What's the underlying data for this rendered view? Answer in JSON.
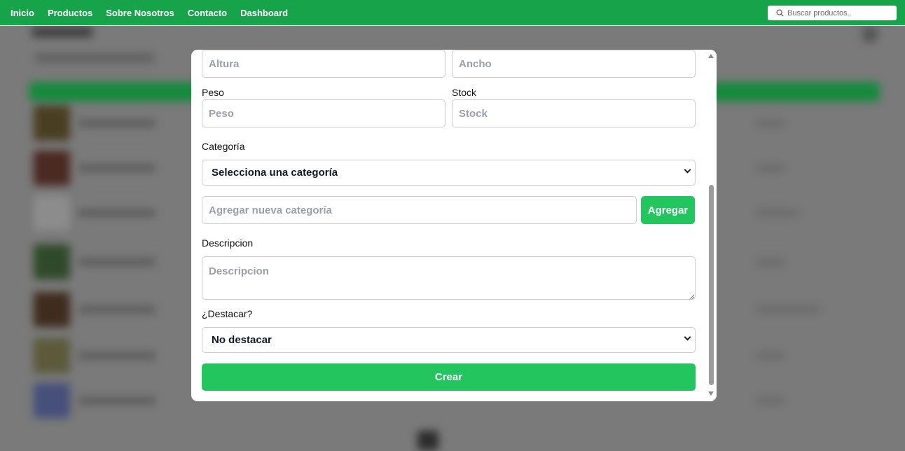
{
  "navbar": {
    "links": [
      "Inicio",
      "Productos",
      "Sobre Nosotros",
      "Contacto",
      "Dashboard"
    ],
    "search_placeholder": "Buscar productos.."
  },
  "colors": {
    "navbar_bg": "#17a34a",
    "button_green": "#22c55e",
    "overlay": "#7a7a7a"
  },
  "modal": {
    "fields": {
      "altura_placeholder": "Altura",
      "ancho_placeholder": "Ancho",
      "peso_label": "Peso",
      "peso_placeholder": "Peso",
      "stock_label": "Stock",
      "stock_placeholder": "Stock",
      "categoria_label": "Categoría",
      "categoria_selected": "Selecciona una categoría",
      "nueva_categoria_placeholder": "Agregar nueva categoría",
      "agregar_button": "Agregar",
      "descripcion_label": "Descripcion",
      "descripcion_placeholder": "Descripcion",
      "destacar_label": "¿Destacar?",
      "destacar_selected": "No destacar",
      "crear_button": "Crear"
    }
  },
  "icons": {
    "search": "search-icon",
    "select_arrow": "chevron-down-icon",
    "scroll_up": "scroll-up-arrow",
    "scroll_down": "scroll-down-arrow"
  }
}
